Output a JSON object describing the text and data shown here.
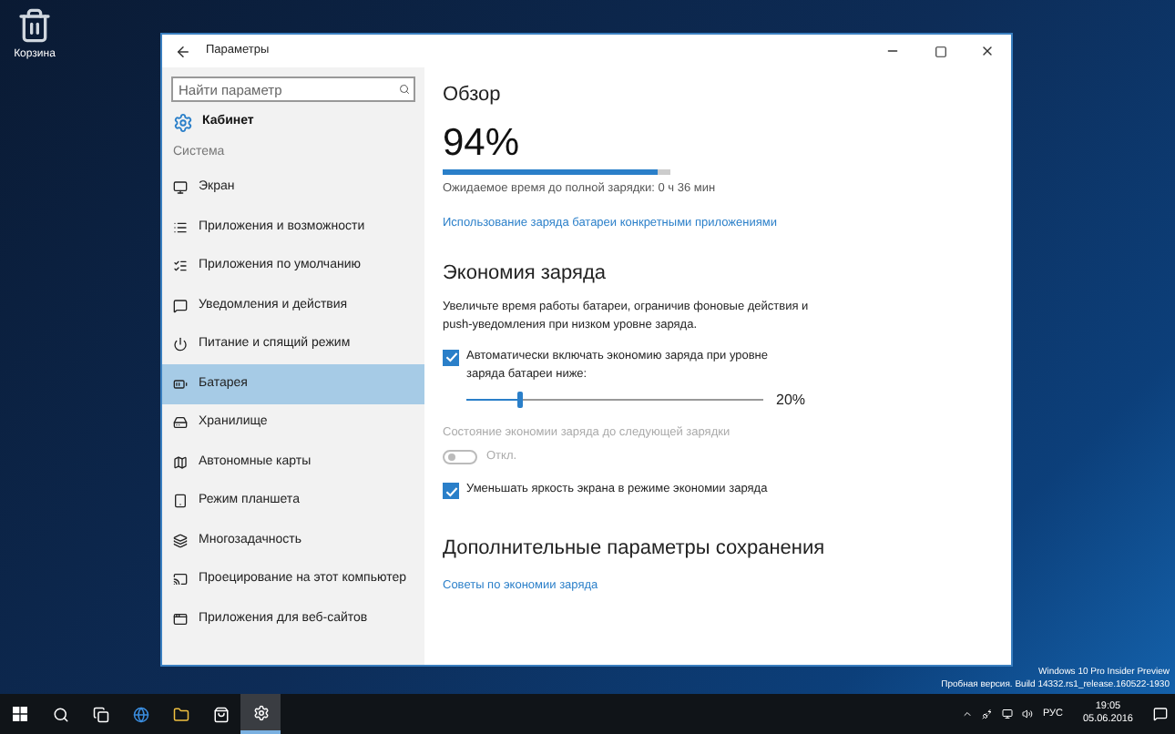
{
  "desktop_icons": [
    {
      "label": "Корзина"
    }
  ],
  "window": {
    "title": "Параметры",
    "search": {
      "placeholder": "Найти параметр"
    },
    "home": "Кабинет",
    "section": "Система",
    "nav": [
      {
        "label": "Экран",
        "selected": false
      },
      {
        "label": "Приложения и возможности",
        "selected": false
      },
      {
        "label": "Приложения по умолчанию",
        "selected": false
      },
      {
        "label": "Уведомления и действия",
        "selected": false
      },
      {
        "label": "Питание и спящий режим",
        "selected": false
      },
      {
        "label": "Батарея",
        "selected": true
      },
      {
        "label": "Хранилище",
        "selected": false
      },
      {
        "label": "Автономные карты",
        "selected": false
      },
      {
        "label": "Режим планшета",
        "selected": false
      },
      {
        "label": "Многозадачность",
        "selected": false
      },
      {
        "label": "Проецирование на этот компьютер",
        "selected": false
      },
      {
        "label": "Приложения для веб-сайтов",
        "selected": false
      }
    ],
    "content": {
      "overview_heading": "Обзор",
      "percent": "94%",
      "charge": {
        "level": 0.94
      },
      "estimate": "Ожидаемое время до полной зарядки: 0 ч 36 мин",
      "usage_link": "Использование заряда батареи конкретными приложениями",
      "saver_heading": "Экономия заряда",
      "saver_description": "Увеличьте время работы батареи, ограничив фоновые действия и push-уведомления при низком уровне заряда.",
      "auto_checkbox": {
        "label": "Автоматически включать экономию заряда при уровне заряда батареи ниже:",
        "checked": true
      },
      "threshold_slider": {
        "level": 0.18,
        "reading": "20%"
      },
      "status_label": "Состояние экономии заряда до следующей зарядки",
      "status_toggle": {
        "on": false,
        "disabled": true,
        "label": "Откл."
      },
      "brightness_checkbox": {
        "label": "Уменьшать яркость экрана в режиме экономии заряда",
        "checked": true
      },
      "more_heading": "Дополнительные параметры сохранения",
      "tips_link": "Советы по экономии заряда"
    }
  },
  "build_info": [
    "Windows 10 Pro Insider Preview",
    "Пробная версия. Build 14332.rs1_release.160522-1930"
  ],
  "taskbar": {
    "apps": [
      {
        "kind": "search",
        "selected": false
      },
      {
        "kind": "taskview",
        "selected": false
      },
      {
        "kind": "browser",
        "selected": false
      },
      {
        "kind": "folder",
        "selected": false
      },
      {
        "kind": "store",
        "selected": false
      },
      {
        "kind": "settings",
        "selected": true
      }
    ],
    "language": "РУС",
    "time": "19:05",
    "date": "05.06.2016"
  }
}
